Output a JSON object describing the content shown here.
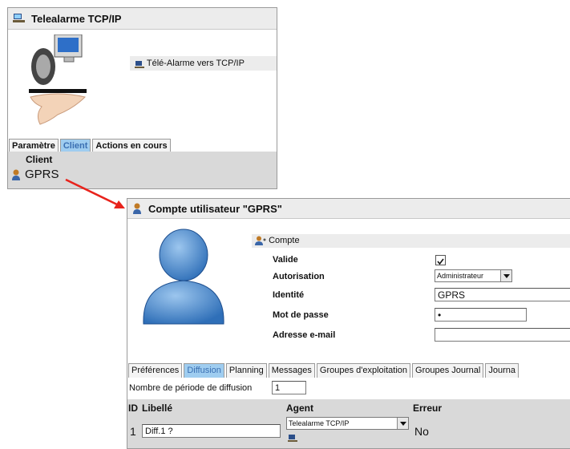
{
  "top_window": {
    "title": "Telealarme TCP/IP",
    "subtitle": "Télé-Alarme vers TCP/IP",
    "tabs": [
      "Paramètre",
      "Client",
      "Actions en cours"
    ],
    "table_header": "Client",
    "row_value": "GPRS"
  },
  "account_window": {
    "title": "Compte utilisateur \"GPRS\"",
    "section_title": "Compte",
    "fields": {
      "valide_label": "Valide",
      "valide_checked": true,
      "autorisation_label": "Autorisation",
      "autorisation_value": "Administrateur",
      "identite_label": "Identité",
      "identite_value": "GPRS",
      "password_label": "Mot de passe",
      "password_value": "•",
      "email_label": "Adresse e-mail",
      "email_value": ""
    },
    "tabs": [
      "Préférences",
      "Diffusion",
      "Planning",
      "Messages",
      "Groupes d'exploitation",
      "Groupes Journal",
      "Journa"
    ],
    "period_label": "Nombre de période de diffusion",
    "period_value": "1",
    "columns": [
      "ID",
      "Libellé",
      "Agent",
      "Erreur"
    ],
    "row": {
      "id": "1",
      "libelle": "Diff.1 ?",
      "agent": "Telealarme TCP/IP",
      "erreur": "No"
    }
  },
  "colors": {
    "active_tab": "#9fcdf0",
    "arrow": "#e8231c"
  }
}
